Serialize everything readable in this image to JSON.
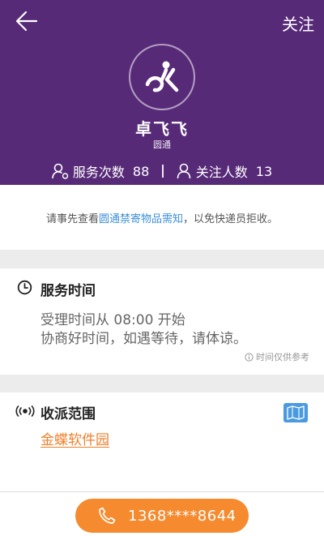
{
  "header": {
    "back_icon": "arrow-left-icon",
    "follow_label": "关注",
    "name": "卓飞飞",
    "company": "圆通",
    "stats": {
      "service_label": "服务次数",
      "service_count": "88",
      "followers_label": "关注人数",
      "followers_count": "13"
    }
  },
  "notice": {
    "prefix": "请事先查看",
    "link": "圆通禁寄物品需知",
    "suffix": "，以免快递员拒收。"
  },
  "service_time": {
    "title": "服务时间",
    "line1": "受理时间从 08:00 开始",
    "line2": "协商好时间，如遇等待，请体谅。",
    "note": "时间仅供参考"
  },
  "delivery_range": {
    "title": "收派范围",
    "area": "金蝶软件园"
  },
  "call": {
    "phone": "1368****8644"
  },
  "colors": {
    "header_bg": "#572a78",
    "accent_orange": "#f58a2f",
    "link_blue": "#3d8fd6"
  }
}
